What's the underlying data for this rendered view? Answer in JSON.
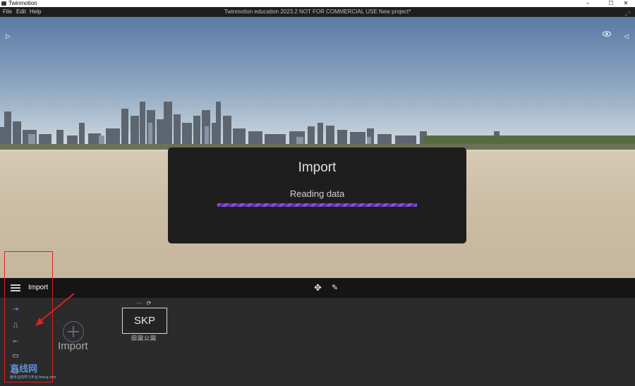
{
  "window": {
    "app_name": "Twinmotion",
    "minimize": "−",
    "maximize": "☐",
    "close": "✕"
  },
  "menubar": {
    "items": [
      "File",
      "Edit",
      "Help"
    ],
    "title": "Twinmotion education 2023.2   NOT FOR COMMERCIAL USE   New project*"
  },
  "viewport": {
    "left_arrow": "▷",
    "eye_icon": "👁",
    "right_arrow": "◁"
  },
  "import_dialog": {
    "title": "Import",
    "status": "Reading data",
    "progress": 1.0,
    "accent": "#8a4fe0"
  },
  "toolbar": {
    "section_title": "Import",
    "move_icon": "✥",
    "brush_icon": "✎"
  },
  "panel": {
    "sidebar_icons": [
      {
        "name": "import-icon",
        "glyph": "⇥",
        "active": true
      },
      {
        "name": "graph-icon",
        "glyph": "⎍",
        "active": false
      },
      {
        "name": "path-icon",
        "glyph": "⟜",
        "active": false
      },
      {
        "name": "media-icon",
        "glyph": "▭",
        "active": false
      },
      {
        "name": "export-icon",
        "glyph": "▢",
        "active": false
      }
    ],
    "import_label": "Import",
    "skp": {
      "dots": "···",
      "refresh": "⟳",
      "label": "SKP",
      "sub_icons": "田図公図"
    }
  },
  "watermark": {
    "text": "直线网",
    "subtitle": "最专业的学习平台 linecg.com"
  }
}
